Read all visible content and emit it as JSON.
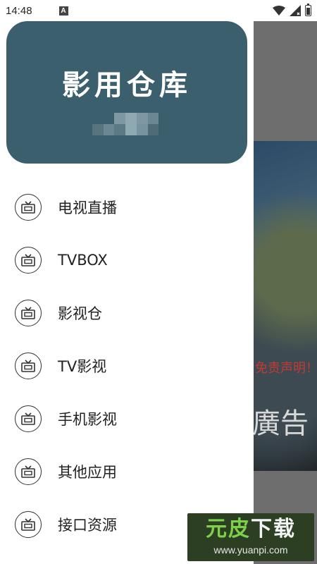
{
  "status_bar": {
    "time": "14:48",
    "a_badge": "A"
  },
  "drawer": {
    "header_title": "影用仓库",
    "header_color": "#3c5f6d",
    "items": [
      {
        "label": "电视直播",
        "icon": "tv-icon"
      },
      {
        "label": "TVBOX",
        "icon": "tv-icon"
      },
      {
        "label": "影视仓",
        "icon": "tv-icon"
      },
      {
        "label": "TV影视",
        "icon": "tv-icon"
      },
      {
        "label": "手机影视",
        "icon": "tv-icon"
      },
      {
        "label": "其他应用",
        "icon": "tv-icon"
      },
      {
        "label": "接口资源",
        "icon": "tv-icon"
      }
    ]
  },
  "background": {
    "text_1": "免责声明！",
    "text_2": "廣告"
  },
  "watermark": {
    "main_1": "元皮",
    "main_2": "下载",
    "url": "www.yuanpi.com"
  }
}
